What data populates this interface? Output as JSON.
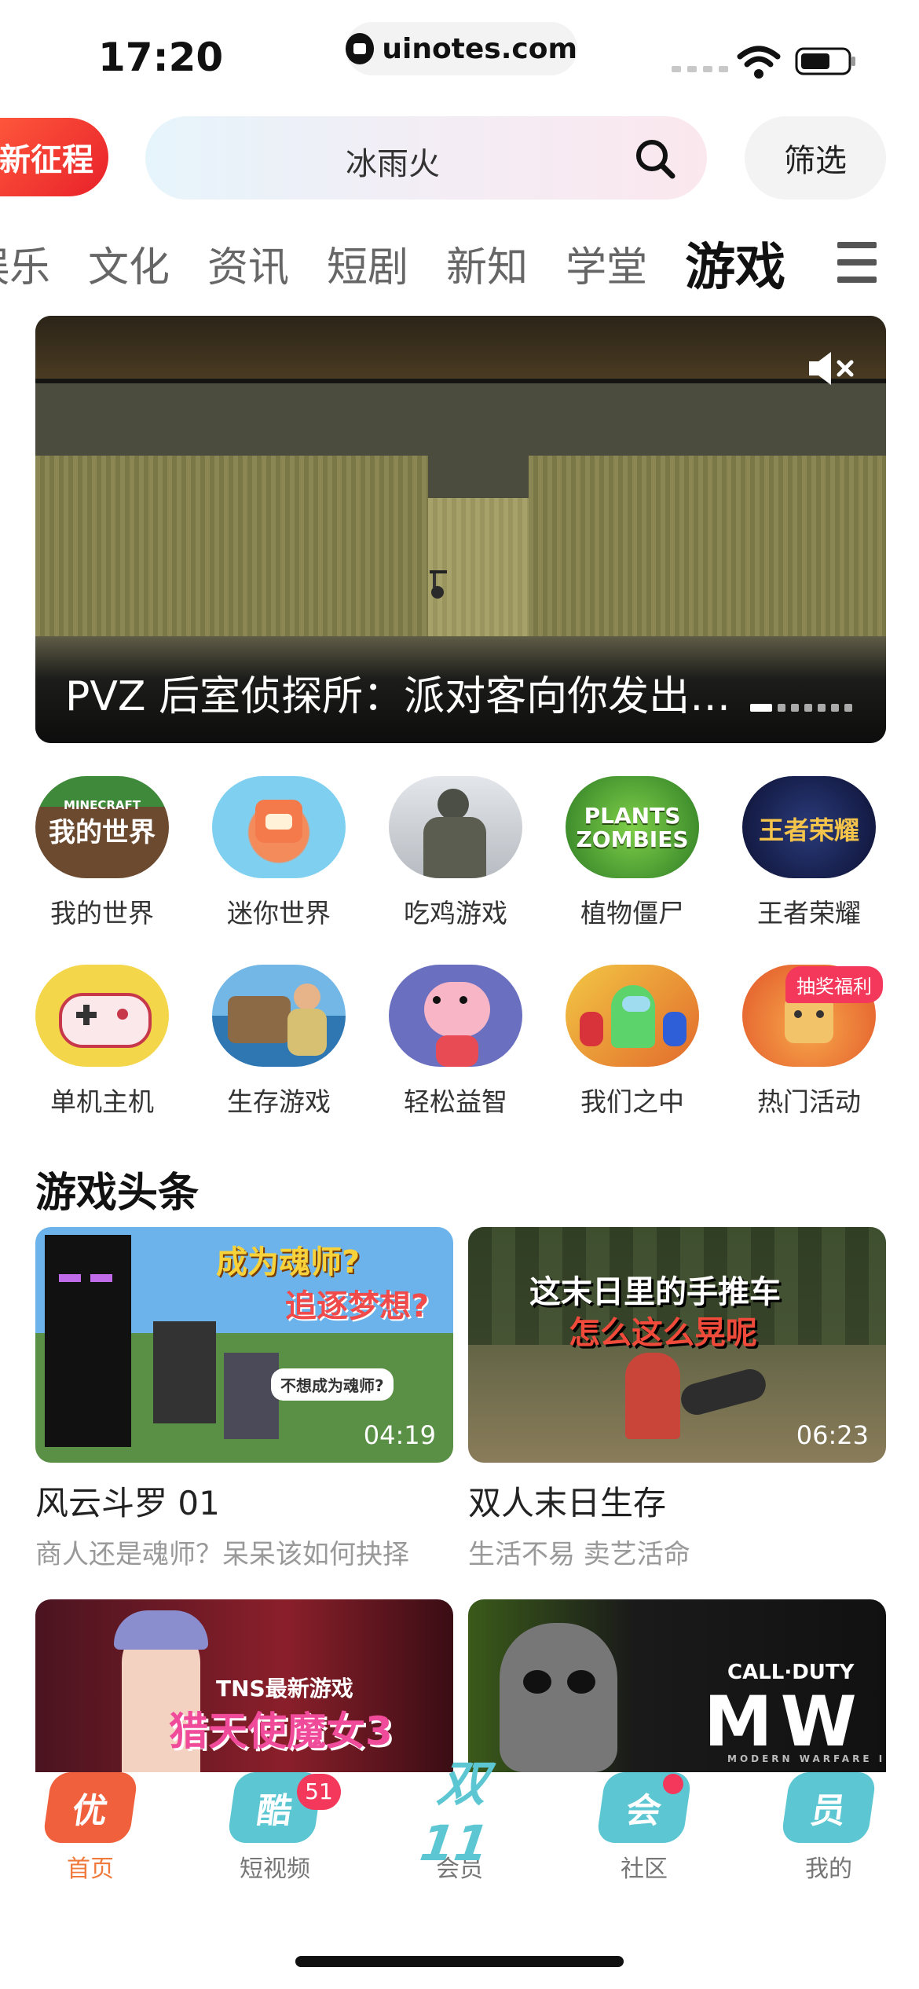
{
  "status_bar": {
    "time": "17:20",
    "url": "uinotes.com"
  },
  "header": {
    "tag": "新征程",
    "search_query": "冰雨火",
    "filter_label": "筛选"
  },
  "tabs": [
    "娱乐",
    "文化",
    "资讯",
    "短剧",
    "新知",
    "学堂",
    "游戏"
  ],
  "active_tab": "游戏",
  "banner": {
    "title": "PVZ 后室侦探所：派对客向你发出…"
  },
  "categories": [
    {
      "label": "我的世界",
      "art": "MINECRAFT"
    },
    {
      "label": "迷你世界"
    },
    {
      "label": "吃鸡游戏"
    },
    {
      "label": "植物僵尸",
      "art": "PLANTS ZOMBIES"
    },
    {
      "label": "王者荣耀",
      "art": "王者荣耀"
    },
    {
      "label": "单机主机"
    },
    {
      "label": "生存游戏"
    },
    {
      "label": "轻松益智"
    },
    {
      "label": "我们之中"
    },
    {
      "label": "热门活动"
    }
  ],
  "prize_badge": "抽奖福利",
  "section": {
    "title": "游戏头条",
    "cards": [
      {
        "title": "风云斗罗 01",
        "subtitle": "商人还是魂师？呆呆该如何抉择",
        "duration": "04:19",
        "overlay": [
          "成为魂师?",
          "追逐梦想?",
          "不想成为魂师?"
        ]
      },
      {
        "title": "双人末日生存",
        "subtitle": "生活不易 卖艺活命",
        "duration": "06:23",
        "overlay": [
          "这末日里的手推车",
          "怎么这么晃呢"
        ]
      },
      {
        "overlay": [
          "TNS最新游戏",
          "猎天使魔女3"
        ]
      },
      {
        "overlay": [
          "CALL·DUTY",
          "MW",
          "MODERN WARFARE II"
        ]
      }
    ]
  },
  "bottom_nav": [
    {
      "label": "首页",
      "icon": "优",
      "color": "#f0603c"
    },
    {
      "label": "短视频",
      "icon": "酷",
      "color": "#5cc7d2"
    },
    {
      "label": "会员",
      "icon": "双11",
      "color": "#5cc7d2"
    },
    {
      "label": "社区",
      "icon": "会",
      "color": "#5cc7d2"
    },
    {
      "label": "我的",
      "icon": "员",
      "color": "#5cc7d2"
    }
  ],
  "badges": {
    "short_video": "51"
  }
}
